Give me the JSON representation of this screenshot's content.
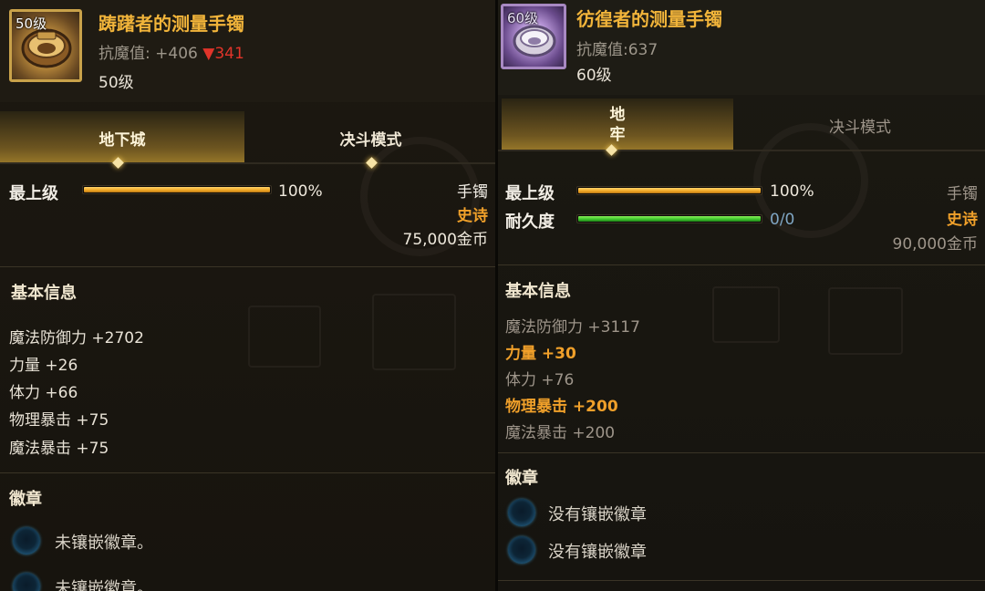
{
  "left": {
    "icon_level": "50级",
    "title": "踌躇者的测量手镯",
    "stat_label": "抗魔值:",
    "stat_plus": "+406",
    "stat_down": "▼341",
    "level": "50级",
    "tabs": [
      {
        "label": "地下城",
        "active": true
      },
      {
        "label": "决斗模式",
        "active": false
      }
    ],
    "max_level_label": "最上级",
    "max_level_progress": 1.0,
    "max_level_pct": "100%",
    "type": "手镯",
    "rarity": "史诗",
    "price": "75,000金币",
    "basic_info_title": "基本信息",
    "attributes": [
      "魔法防御力 +2702",
      "力量 +26",
      "体力 +66",
      "物理暴击 +75",
      "魔法暴击 +75"
    ],
    "emblem_title": "徽章",
    "sockets": [
      "未镶嵌徽章。",
      "未镶嵌徽章。"
    ]
  },
  "right": {
    "icon_level": "60级",
    "title": "彷徨者的测量手镯",
    "stat": "抗魔值:637",
    "level": "60级",
    "tabs": [
      {
        "label_line1": "地",
        "label_line2": "牢",
        "active": true
      },
      {
        "label": "决斗模式",
        "active": false
      }
    ],
    "max_level_label": "最上级",
    "max_level_progress": 1.0,
    "max_level_pct": "100%",
    "durability_label": "耐久度",
    "durability_progress": 1.0,
    "durability_value": "0/0",
    "type": "手镯",
    "rarity": "史诗",
    "price": "90,000金币",
    "basic_info_title": "基本信息",
    "attributes": [
      {
        "text": "魔法防御力 +3117",
        "highlight": false
      },
      {
        "text": "力量 +30",
        "highlight": true
      },
      {
        "text": "体力 +76",
        "highlight": false
      },
      {
        "text": "物理暴击 +200",
        "highlight": true
      },
      {
        "text": "魔法暴击 +200",
        "highlight": false
      }
    ],
    "emblem_title": "徽章",
    "sockets": [
      "没有镶嵌徽章",
      "没有镶嵌徽章"
    ]
  },
  "colors": {
    "title_gold": "#f1b43a",
    "rarity_orange": "#f0a02a",
    "stat_down_red": "#e0342a",
    "bar_gold": "#f0a523",
    "bar_green": "#39c22a"
  }
}
